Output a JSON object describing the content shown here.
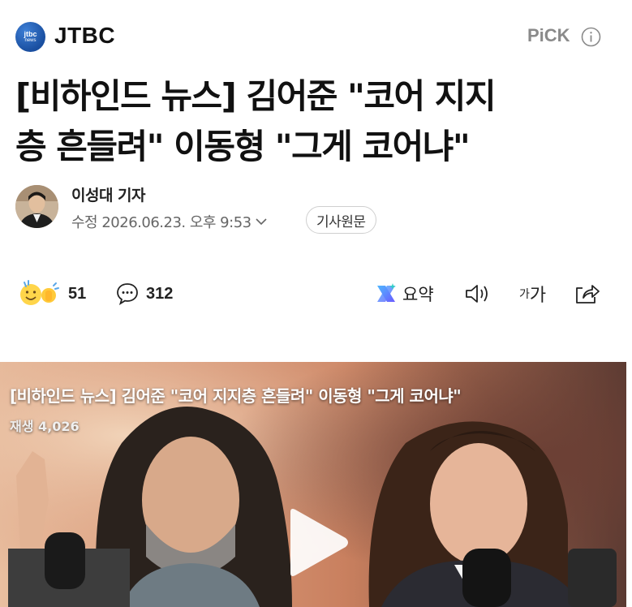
{
  "press": {
    "logo_line1": "jtbc",
    "logo_line2": "news",
    "name": "JTBC"
  },
  "header": {
    "pick_label": "PiCK",
    "info_icon": "info-icon"
  },
  "article": {
    "headline_line1": "[비하인드 뉴스] 김어준 \"코어 지지",
    "headline_line2": "층 흔들려\" 이동형 \"그게 코어냐\"",
    "reporter": "이성대 기자",
    "datetime": "수정 2026.06.23. 오후 9:53",
    "original_button": "기사원문"
  },
  "actions": {
    "reaction_count": "51",
    "comment_count": "312",
    "summary_label": "요약",
    "font_label_small": "가",
    "font_label_large": "가"
  },
  "video": {
    "title": "[비하인드 뉴스] 김어준 \"코어 지지층 흔들려\" 이동형 \"그게 코어냐\"",
    "views": "재생 4,026"
  }
}
